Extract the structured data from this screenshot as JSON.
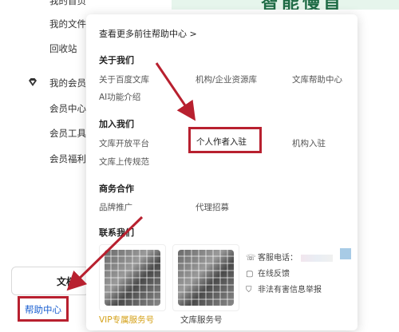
{
  "sidebar": {
    "items": [
      {
        "label": "我的文件"
      },
      {
        "label": "回收站"
      },
      {
        "label": "我的会员"
      },
      {
        "label": "会员中心"
      },
      {
        "label": "会员工具"
      },
      {
        "label": "会员福利"
      }
    ],
    "button_label": "文档",
    "help_label": "帮助中心",
    "top_partial": "我的首页"
  },
  "banner": {
    "text": "智能慢首"
  },
  "popup": {
    "more_link": "查看更多前往帮助中心 >",
    "sections": {
      "about": {
        "title": "关于我们",
        "items": [
          "关于百度文库",
          "机构/企业资源库",
          "文库帮助中心",
          "AI功能介绍"
        ]
      },
      "join": {
        "title": "加入我们",
        "items": [
          "文库开放平台",
          "个人作者入驻",
          "机构入驻",
          "文库上传规范"
        ]
      },
      "business": {
        "title": "商务合作",
        "items": [
          "品牌推广",
          "代理招募"
        ]
      },
      "contact": {
        "title": "联系我们",
        "qr1_caption": "VIP专属服务号",
        "qr2_caption": "文库服务号",
        "hotline": "客服电话：",
        "feedback": "在线反馈",
        "report": "非法有害信息举报"
      }
    }
  },
  "colors": {
    "accent_red": "#b8202f",
    "link_blue": "#1a5fd1",
    "vip_gold": "#d4a017",
    "banner_green": "#e6f5ec"
  }
}
